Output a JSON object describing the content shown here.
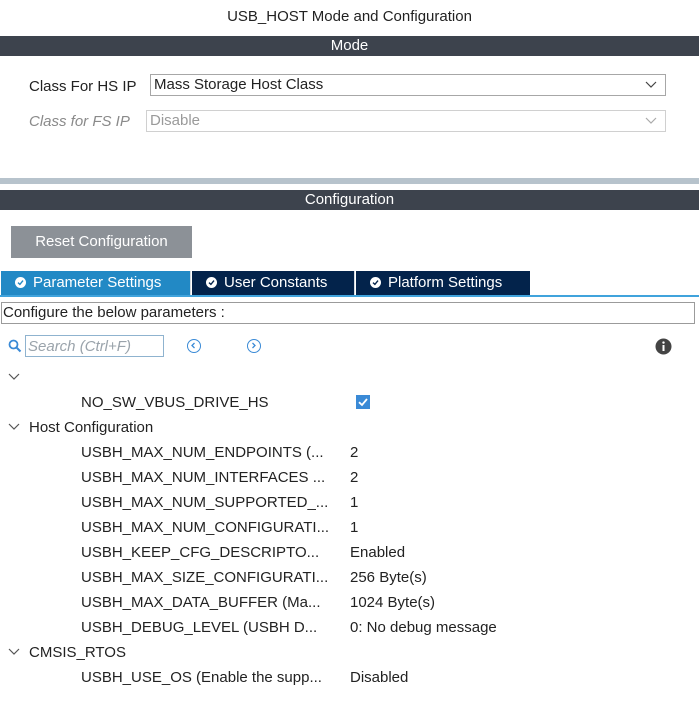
{
  "window_title": "USB_HOST Mode and Configuration",
  "mode_section": {
    "header": "Mode",
    "hs_ip": {
      "label": "Class For HS IP",
      "value": "Mass Storage Host Class"
    },
    "fs_ip": {
      "label": "Class for FS IP",
      "value": "Disable"
    }
  },
  "config_section": {
    "header": "Configuration",
    "reset_label": "Reset Configuration",
    "tabs": [
      {
        "label": "Parameter Settings",
        "active": true
      },
      {
        "label": "User Constants",
        "active": false
      },
      {
        "label": "Platform Settings",
        "active": false
      }
    ],
    "description": "Configure the below parameters :",
    "search_placeholder": "Search (Ctrl+F)"
  },
  "groups": {
    "ungrouped": {
      "params": [
        {
          "name": "NO_SW_VBUS_DRIVE_HS",
          "checked": true
        }
      ]
    },
    "host": {
      "name": "Host Configuration",
      "params": [
        {
          "name": "USBH_MAX_NUM_ENDPOINTS (...",
          "value": "2"
        },
        {
          "name": "USBH_MAX_NUM_INTERFACES ...",
          "value": "2"
        },
        {
          "name": "USBH_MAX_NUM_SUPPORTED_...",
          "value": "1"
        },
        {
          "name": "USBH_MAX_NUM_CONFIGURATI...",
          "value": "1"
        },
        {
          "name": "USBH_KEEP_CFG_DESCRIPTO...",
          "value": "Enabled"
        },
        {
          "name": "USBH_MAX_SIZE_CONFIGURATI...",
          "value": "256 Byte(s)"
        },
        {
          "name": "USBH_MAX_DATA_BUFFER (Ma...",
          "value": "1024 Byte(s)"
        },
        {
          "name": "USBH_DEBUG_LEVEL (USBH D...",
          "value": "0: No debug message"
        }
      ]
    },
    "cmsis": {
      "name": "CMSIS_RTOS",
      "params": [
        {
          "name": "USBH_USE_OS (Enable the supp...",
          "value": "Disabled"
        }
      ]
    }
  },
  "colors": {
    "section_bar": "#3d434d",
    "tab_active": "#2289c5",
    "tab_inactive": "#03234b",
    "accent": "#40a3dc",
    "checkbox": "#3a8ad6"
  }
}
